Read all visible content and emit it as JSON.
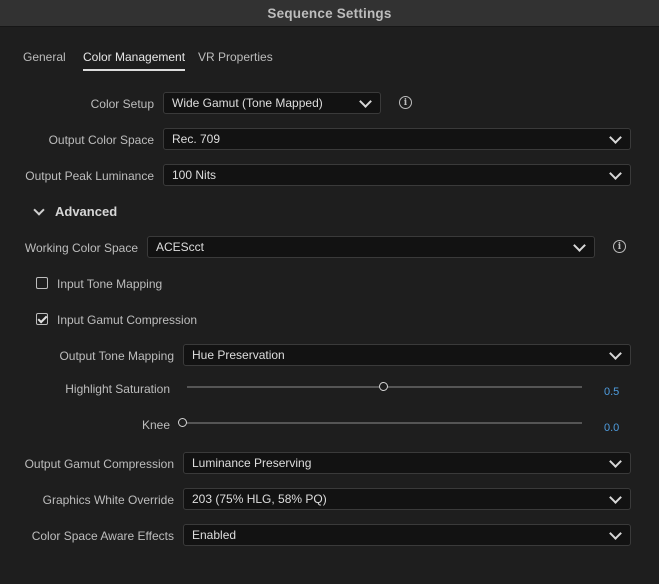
{
  "window": {
    "title": "Sequence Settings"
  },
  "tabs": [
    {
      "label": "General",
      "active": false
    },
    {
      "label": "Color Management",
      "active": true
    },
    {
      "label": "VR Properties",
      "active": false
    }
  ],
  "color_setup": {
    "label": "Color Setup",
    "value": "Wide Gamut (Tone Mapped)",
    "info_icon": "info-icon"
  },
  "output_color_space": {
    "label": "Output Color Space",
    "value": "Rec. 709"
  },
  "output_peak_luminance": {
    "label": "Output Peak Luminance",
    "value": "100 Nits"
  },
  "advanced": {
    "label": "Advanced",
    "expanded": true
  },
  "working_color_space": {
    "label": "Working Color Space",
    "value": "ACEScct",
    "info_icon": "info-icon"
  },
  "input_tone_mapping": {
    "label": "Input Tone Mapping",
    "checked": false
  },
  "input_gamut_compression": {
    "label": "Input Gamut Compression",
    "checked": true
  },
  "output_tone_mapping": {
    "label": "Output Tone Mapping",
    "value": "Hue Preservation"
  },
  "highlight_saturation": {
    "label": "Highlight Saturation",
    "value": "0.5",
    "fraction": 0.5
  },
  "knee": {
    "label": "Knee",
    "value": "0.0",
    "fraction": 0.0
  },
  "output_gamut_compression": {
    "label": "Output Gamut Compression",
    "value": "Luminance Preserving"
  },
  "graphics_white_override": {
    "label": "Graphics White Override",
    "value": "203 (75% HLG, 58% PQ)"
  },
  "color_space_aware_effects": {
    "label": "Color Space Aware Effects",
    "value": "Enabled"
  },
  "colors": {
    "background": "#1e1e1e",
    "field": "#121212",
    "accent_value": "#4f9ddf",
    "titlebar": "#323232"
  }
}
